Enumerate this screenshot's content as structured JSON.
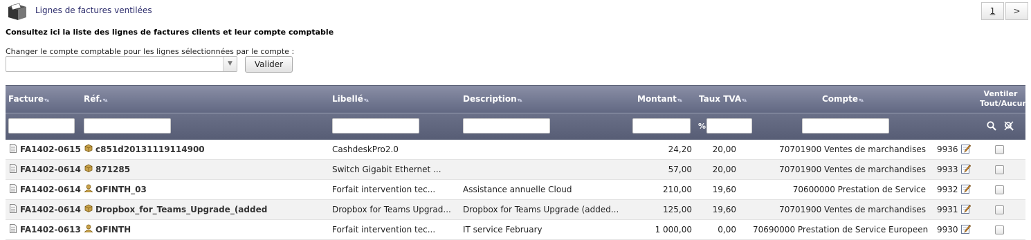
{
  "header": {
    "title": "Lignes de factures ventilées",
    "pager": {
      "current": "1",
      "next": ">"
    }
  },
  "intro_text": "Consultez ici la liste des lignes de factures clients et leur compte comptable",
  "change_account": {
    "label": "Changer le compte comptable pour les lignes sélectionnées par le compte :",
    "select_value": "",
    "button_label": "Valider"
  },
  "table": {
    "columns": {
      "facture": "Facture",
      "ref": "Réf.",
      "libelle": "Libellé",
      "description": "Description",
      "montant": "Montant",
      "taux_tva": "Taux TVA",
      "compte": "Compte",
      "ventiler_line1": "Ventiler",
      "ventiler_line2": "Tout/Aucun"
    },
    "sort_glyph": "▾▴",
    "percent_label": "%",
    "rows": [
      {
        "facture": "FA1402-0615",
        "ref": "c851d20131119114900",
        "ref_icon": "product-icon",
        "libelle": "CashdeskPro2.0",
        "description": "",
        "montant": "24,20",
        "taux_tva": "20,00",
        "compte": "70701900 Ventes de marchandises",
        "id": "9936"
      },
      {
        "facture": "FA1402-0614",
        "ref": "871285",
        "ref_icon": "product-icon",
        "libelle": "Switch Gigabit Ethernet ...",
        "description": "",
        "montant": "57,00",
        "taux_tva": "20,00",
        "compte": "70701900 Ventes de marchandises",
        "id": "9933"
      },
      {
        "facture": "FA1402-0614",
        "ref": "OFINTH_03",
        "ref_icon": "service-icon",
        "libelle": "Forfait intervention tec...",
        "description": "Assistance annuelle Cloud",
        "montant": "210,00",
        "taux_tva": "19,60",
        "compte": "70600000 Prestation de Service",
        "id": "9932"
      },
      {
        "facture": "FA1402-0614",
        "ref": "Dropbox_for_Teams_Upgrade_(added",
        "ref_icon": "product-icon",
        "libelle": "Dropbox for Teams Upgrad...",
        "description": "Dropbox for Teams Upgrade (added...",
        "montant": "125,00",
        "taux_tva": "19,60",
        "compte": "70701900 Ventes de marchandises",
        "id": "9931"
      },
      {
        "facture": "FA1402-0613",
        "ref": "OFINTH",
        "ref_icon": "service-icon",
        "libelle": "Forfait intervention tec...",
        "description": "IT service February",
        "montant": "1 000,00",
        "taux_tva": "0,00",
        "compte": "70690000 Prestation de Service Europeen",
        "id": "9930"
      }
    ]
  },
  "colors": {
    "header_gradient_top": "#8a8fa6",
    "header_gradient_bottom": "#616882",
    "title_text": "#2b2b6b",
    "row_alt": "#f2f2f2"
  }
}
